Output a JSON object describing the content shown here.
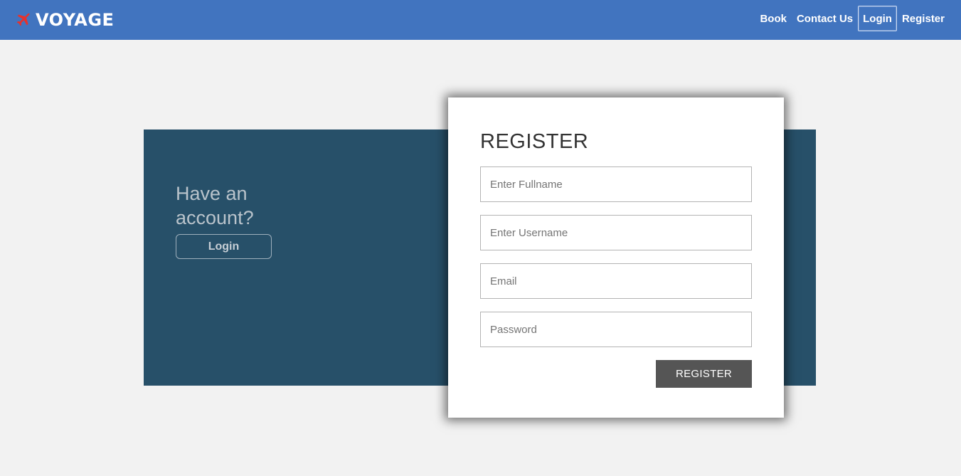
{
  "brand": {
    "name": "VOYAGE",
    "icon": "airplane-icon",
    "icon_color": "#e8312b"
  },
  "nav": {
    "items": [
      {
        "label": "Book"
      },
      {
        "label": "Contact Us"
      },
      {
        "label": "Login",
        "active": true
      },
      {
        "label": "Register"
      }
    ]
  },
  "side": {
    "prompt": "Have an account?",
    "login_label": "Login"
  },
  "form": {
    "title": "REGISTER",
    "fields": [
      {
        "placeholder": "Enter Fullname",
        "value": ""
      },
      {
        "placeholder": "Enter Username",
        "value": ""
      },
      {
        "placeholder": "Email",
        "value": ""
      },
      {
        "placeholder": "Password",
        "value": ""
      }
    ],
    "submit_label": "REGISTER"
  },
  "colors": {
    "navbar": "#4174bf",
    "panel": "#275069",
    "background": "#f2f2f2",
    "submit_button": "#555555"
  }
}
